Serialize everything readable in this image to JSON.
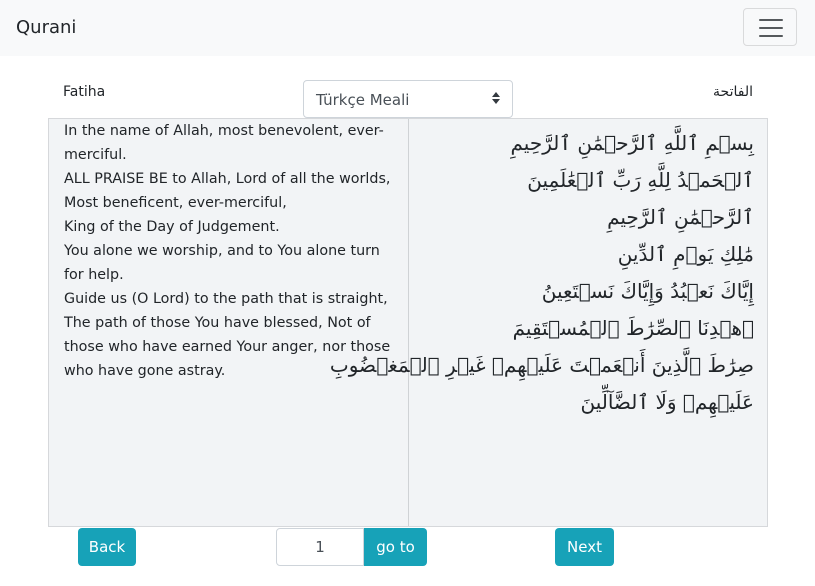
{
  "navbar": {
    "brand": "Qurani",
    "menu_icon": "hamburger-menu-icon"
  },
  "surah": {
    "name_latin": "Fatiha",
    "name_arabic": "الفاتحة"
  },
  "translation_select": {
    "selected": "Türkçe Meali"
  },
  "translation_text": [
    "In the name of Allah, most benevolent, ever-merciful.",
    "ALL PRAISE BE to Allah, Lord of all the worlds,",
    "Most beneficent, ever-merciful,",
    "King of the Day of Judgement.",
    "You alone we worship, and to You alone turn for help.",
    "Guide us (O Lord) to the path that is straight,",
    "The path of those You have blessed, Not of those who have earned Your anger, nor those who have gone astray."
  ],
  "arabic_text": [
    "بِسۡمِ ٱللَّهِ ٱلرَّحۡمَٰنِ ٱلرَّحِيمِ",
    "ٱلۡحَمۡدُ لِلَّهِ رَبِّ ٱلۡعَٰلَمِينَ",
    "ٱلرَّحۡمَٰنِ ٱلرَّحِيمِ",
    "مَٰلِكِ يَوۡمِ ٱلدِّينِ",
    "إِيَّاكَ نَعۡبُدُ وَإِيَّاكَ نَسۡتَعِينُ",
    "ٱهۡدِنَا ٱلصِّرَٰطَ ٱلۡمُسۡتَقِيمَ",
    "صِرَٰطَ ٱلَّذِينَ أَنۡعَمۡتَ عَلَيۡهِمۡ غَيۡرِ ٱلۡمَغۡضُوبِ",
    "عَلَيۡهِمۡ وَلَا ٱلضَّآلِّينَ"
  ],
  "controls": {
    "back_label": "Back",
    "page_value": "1",
    "goto_label": "go to",
    "next_label": "Next"
  },
  "colors": {
    "accent": "#17a2b8",
    "navbar_bg": "#f8f9fa",
    "panel_bg": "#f2f4f6"
  }
}
